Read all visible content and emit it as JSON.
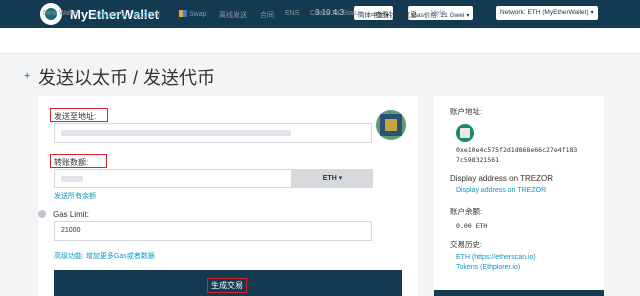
{
  "header": {
    "app_name": "MyEtherWallet",
    "version": "3.10.4.3",
    "language_label": "简体中文",
    "gas_label": "Gas价格: 21 Gwei",
    "network_label": "Network: ETH (MyEtherWallet)"
  },
  "nav": {
    "items": [
      {
        "label": "New Wallet"
      },
      {
        "label": "发送以太币 / 发送代币"
      },
      {
        "label": "Swap"
      },
      {
        "label": "离线发送"
      },
      {
        "label": "合同"
      },
      {
        "label": "ENS"
      },
      {
        "label": "Check TX Status"
      },
      {
        "label": "查看钱包信息"
      },
      {
        "label": "Help"
      }
    ]
  },
  "page": {
    "title": "发送以太币 / 发送代币"
  },
  "form": {
    "to_address_label": "发送至地址:",
    "amount_label": "转账数额:",
    "currency": "ETH",
    "send_all_link": "发送所有余额",
    "gas_limit_label": "Gas Limit:",
    "gas_limit_value": "21000",
    "advanced_link": "高级功能: 增加更多Gas或者数据",
    "generate_button": "生成交易"
  },
  "sidebar": {
    "account_address_label": "账户地址:",
    "address_line1": "0xe10e4c575f2d1d868e66c27e4f183",
    "address_line2": "7c598321561",
    "display_on_label": "Display address on TREZOR",
    "display_on_link": "Display address on TREZOR",
    "balance_label": "账户余额:",
    "balance_value": "0.00 ETH",
    "history_label": "交易历史:",
    "history_links": [
      "ETH (https://etherscan.io)",
      "Tokens (Ethplorer.io)"
    ]
  }
}
